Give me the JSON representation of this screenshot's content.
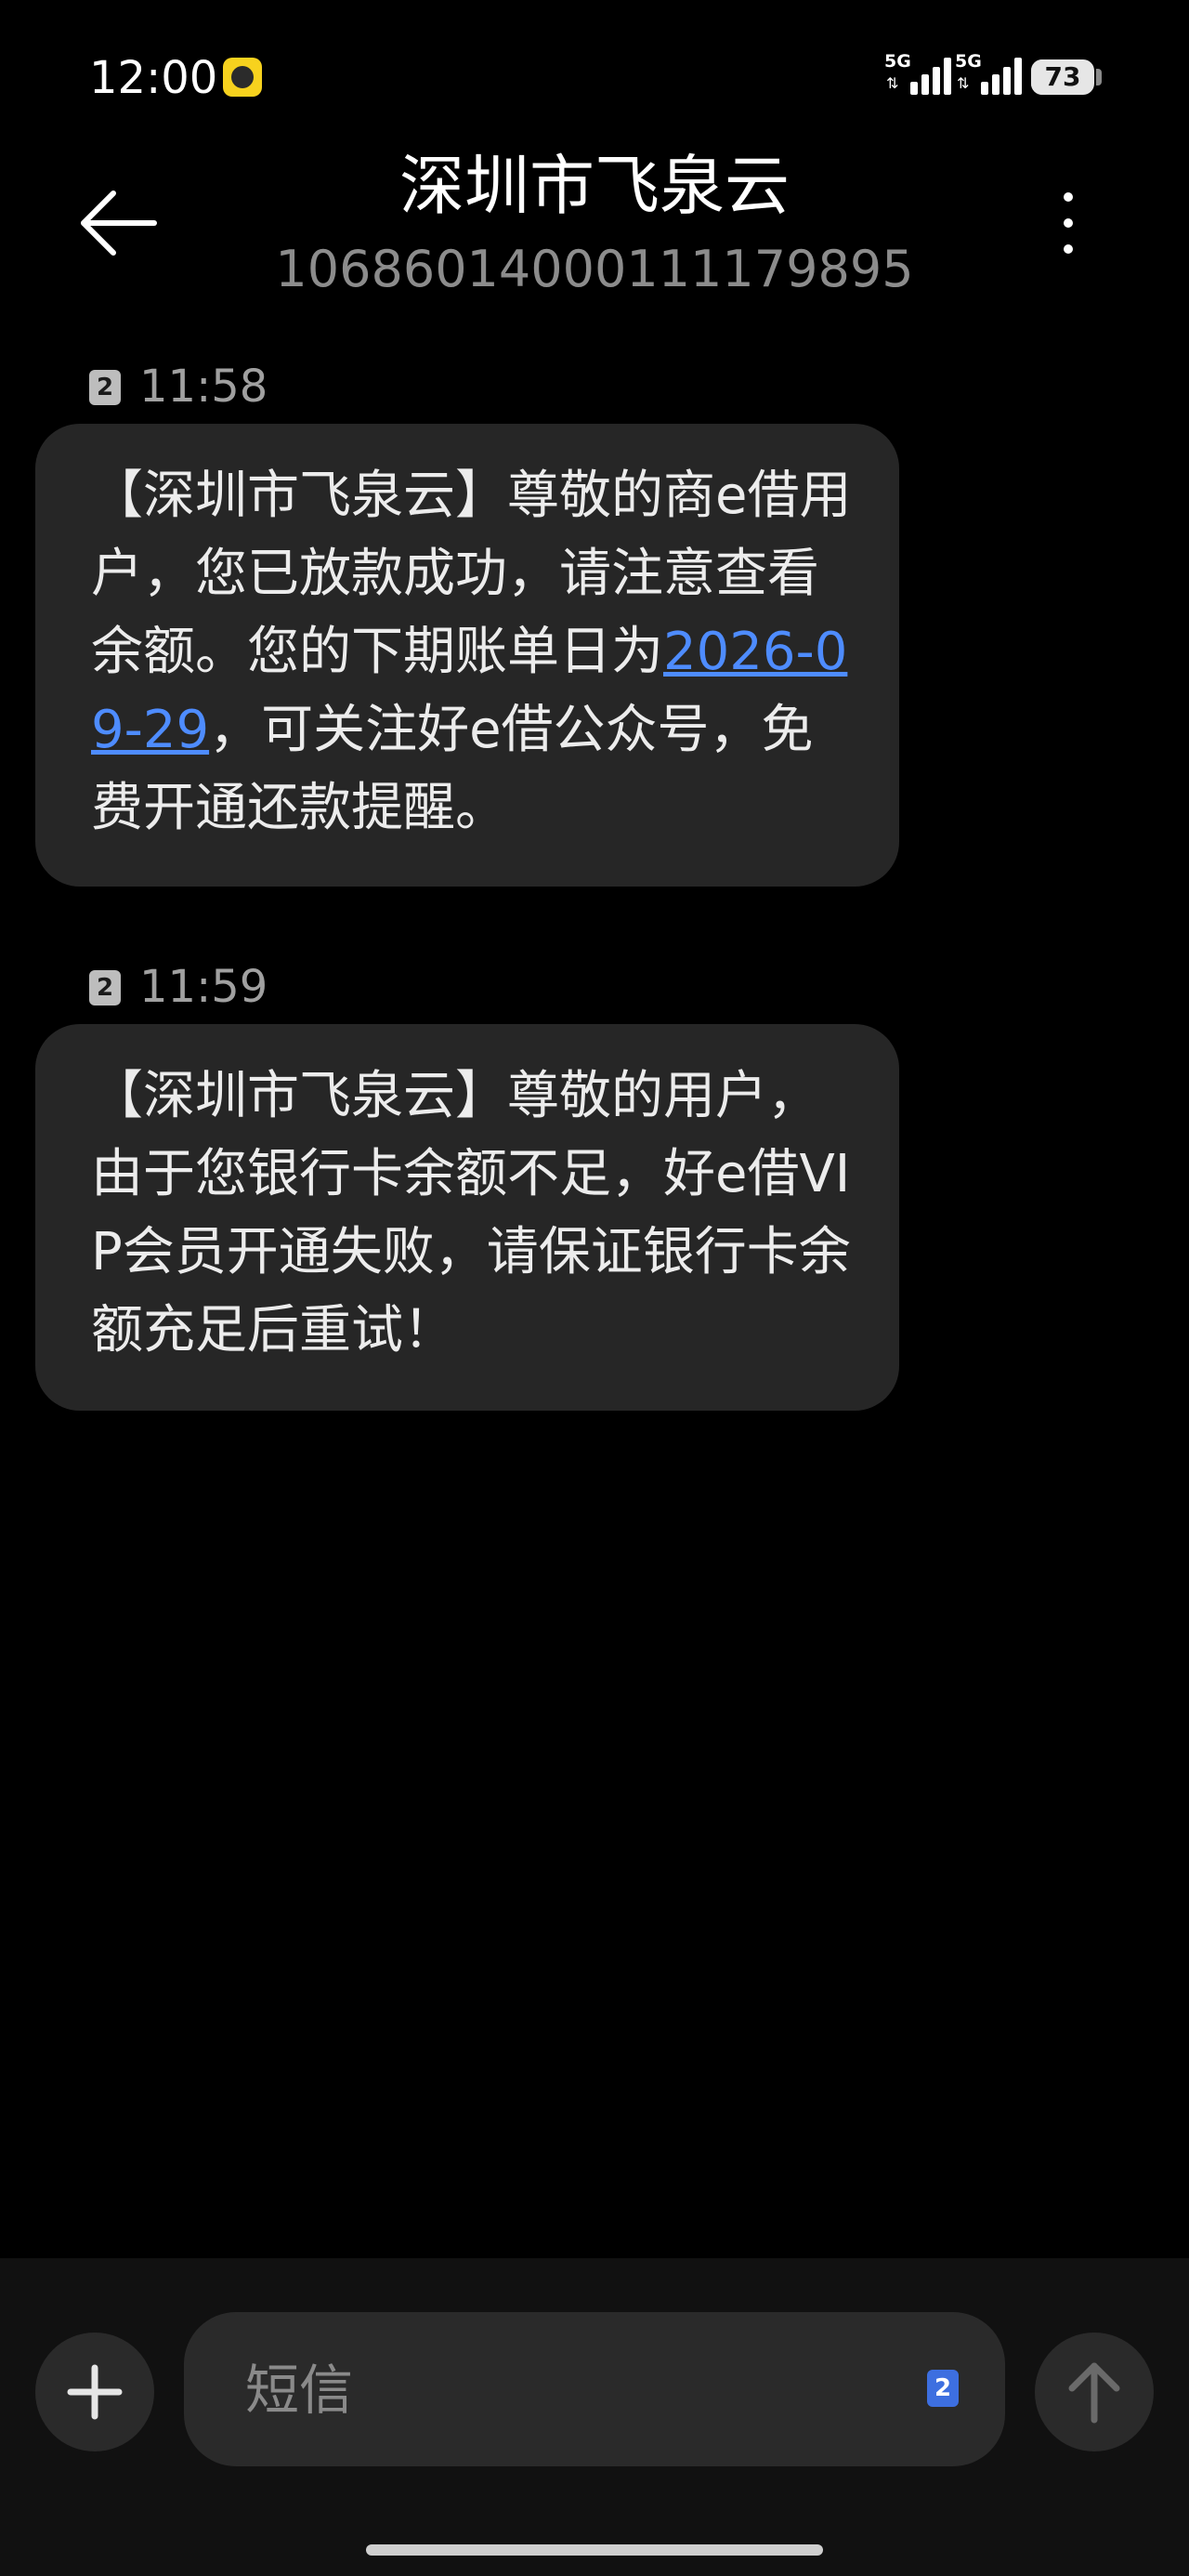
{
  "status_bar": {
    "time": "12:00",
    "signals": [
      {
        "label": "5G",
        "arrows": "⇅"
      },
      {
        "label": "5G",
        "arrows": "⇅"
      }
    ],
    "battery_percent": 73,
    "battery_text": "73"
  },
  "header": {
    "back_icon": "arrow-left-icon",
    "menu_icon": "more-vertical-icon",
    "contact_name": "深圳市飞泉云",
    "contact_number": "106860140001111798​95"
  },
  "messages": [
    {
      "sim": "2",
      "time": "11:58",
      "text_before": "【深圳市飞泉云】尊敬的商e借用户，您已放款成功，请注意查看余额。您的下期账单日为",
      "link": "2026-09-29",
      "text_after": "，可关注好e借公众号，免费开通还款提醒。"
    },
    {
      "sim": "2",
      "time": "11:59",
      "text": "【深圳市飞泉云】尊敬的用户，由于您银行卡余额不足，好e借VIP会员开通失败，请保证银行卡余额充足后重试！"
    }
  ],
  "composer": {
    "add_icon": "plus-icon",
    "placeholder": "短信",
    "sim": "2",
    "send_icon": "arrow-up-icon"
  },
  "colors": {
    "background": "#000000",
    "bubble": "#262626",
    "link": "#4e8cff",
    "sim_badge_active": "#3d6fe0"
  }
}
